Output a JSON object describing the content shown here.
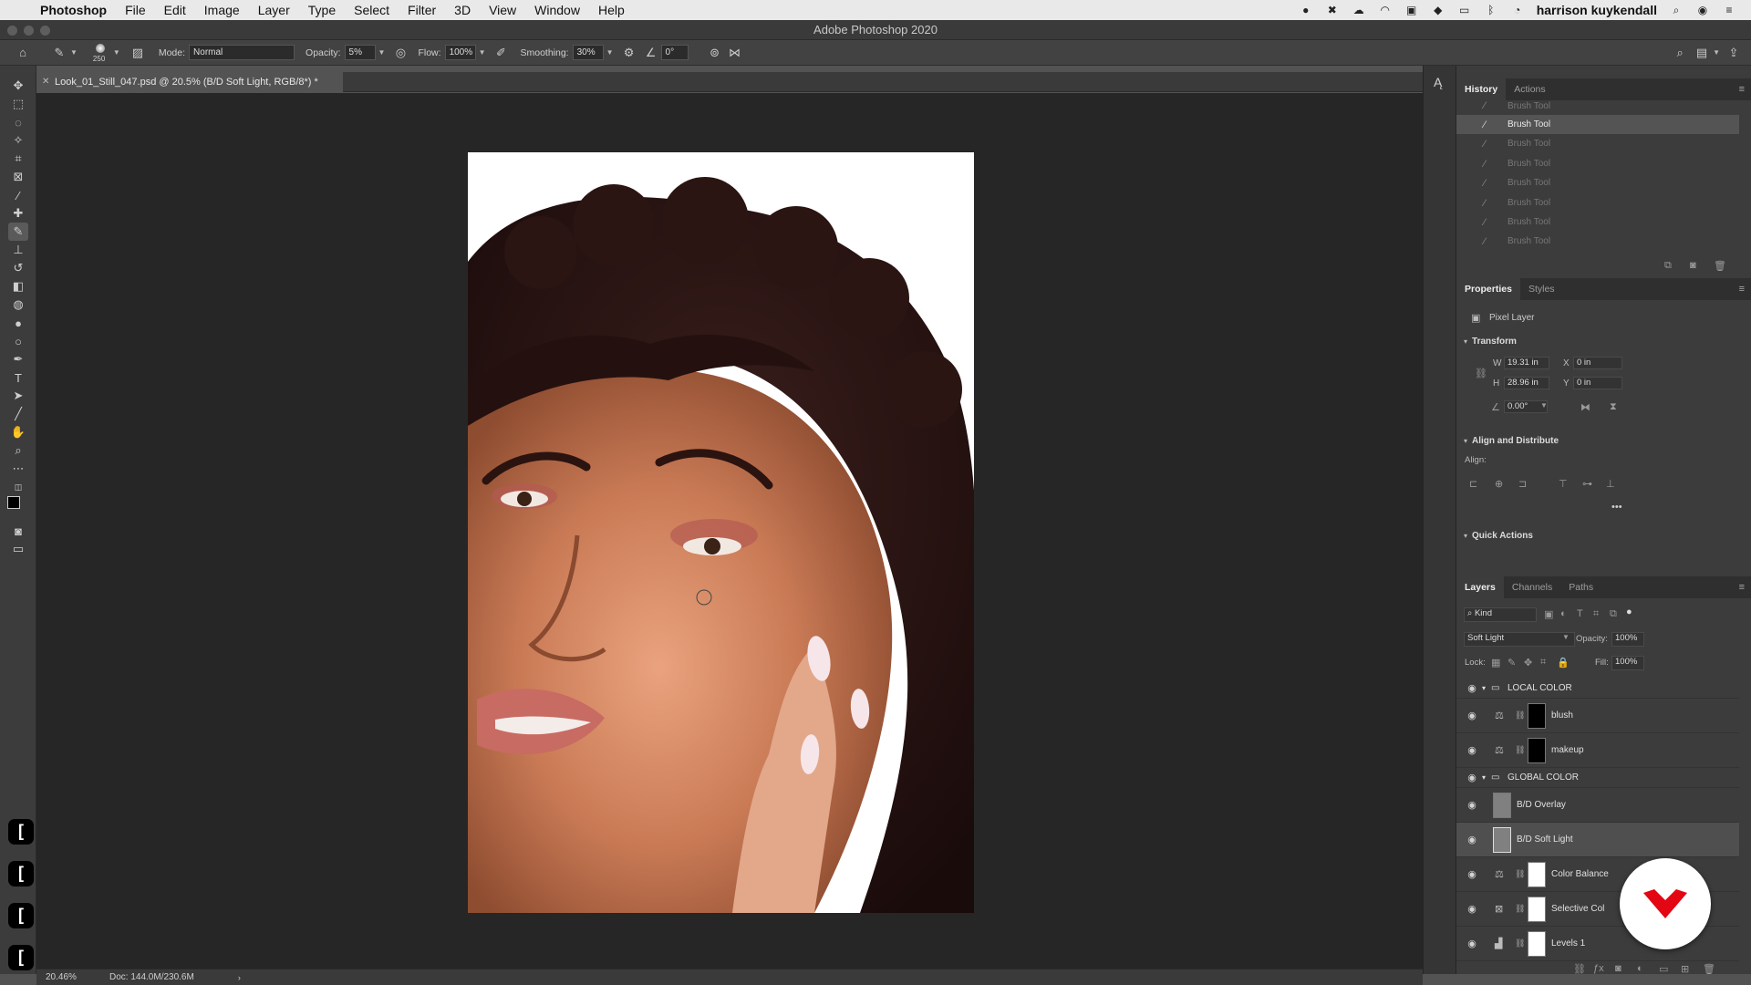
{
  "macbar": {
    "app": "Photoshop",
    "menus": [
      "File",
      "Edit",
      "Image",
      "Layer",
      "Type",
      "Select",
      "Filter",
      "3D",
      "View",
      "Window",
      "Help"
    ],
    "user": "harrison kuykendall"
  },
  "window": {
    "title": "Adobe Photoshop 2020"
  },
  "options": {
    "brush_size": "250",
    "mode_label": "Mode:",
    "mode": "Normal",
    "opacity_label": "Opacity:",
    "opacity": "5%",
    "flow_label": "Flow:",
    "flow": "100%",
    "smoothing_label": "Smoothing:",
    "smoothing": "30%",
    "angle": "0°"
  },
  "document": {
    "tab_title": "Look_01_Still_047.psd @ 20.5% (B/D Soft Light, RGB/8*) *",
    "zoom": "20.46%",
    "doc_size": "Doc: 144.0M/230.6M"
  },
  "history": {
    "tabs": [
      "History",
      "Actions"
    ],
    "partial_item": "Brush Tool",
    "items": [
      "Brush Tool",
      "Brush Tool",
      "Brush Tool",
      "Brush Tool",
      "Brush Tool",
      "Brush Tool",
      "Brush Tool"
    ]
  },
  "properties": {
    "tabs": [
      "Properties",
      "Styles"
    ],
    "layer_type": "Pixel Layer",
    "transform_title": "Transform",
    "w_label": "W",
    "w": "19.31 in",
    "x_label": "X",
    "x": "0 in",
    "h_label": "H",
    "h": "28.96 in",
    "y_label": "Y",
    "y": "0 in",
    "angle": "0.00°",
    "align_title": "Align and Distribute",
    "align_label": "Align:",
    "quick_title": "Quick Actions"
  },
  "layers": {
    "tabs": [
      "Layers",
      "Channels",
      "Paths"
    ],
    "filter": "Kind",
    "blend": "Soft Light",
    "opacity_label": "Opacity:",
    "opacity": "100%",
    "lock_label": "Lock:",
    "fill_label": "Fill:",
    "fill": "100%",
    "rows": [
      "LOCAL COLOR",
      "blush",
      "makeup",
      "GLOBAL COLOR",
      "B/D Overlay",
      "B/D Soft Light",
      "Color Balance",
      "Selective Col",
      "Levels 1"
    ]
  },
  "colors": {
    "accent": "#e30613",
    "canvas": "#262626",
    "panel": "#3c3c3c"
  }
}
